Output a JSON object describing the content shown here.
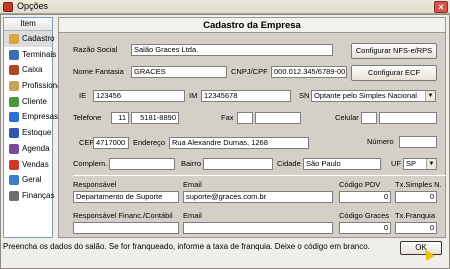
{
  "window": {
    "title": "Opções",
    "close_glyph": "×"
  },
  "sidebar": {
    "header": "Item",
    "items": [
      {
        "label": "Cadastro",
        "icon": "folder-icon",
        "color": "#d9a441"
      },
      {
        "label": "Terminais",
        "icon": "computer-icon",
        "color": "#3a6fb0"
      },
      {
        "label": "Caixa",
        "icon": "cash-register-icon",
        "color": "#b5471f"
      },
      {
        "label": "Profissional",
        "icon": "person-icon",
        "color": "#c8a25a"
      },
      {
        "label": "Cliente",
        "icon": "customer-icon",
        "color": "#4a9a3b"
      },
      {
        "label": "Empresas",
        "icon": "info-icon",
        "color": "#2e6fd3"
      },
      {
        "label": "Estoque",
        "icon": "stock-icon",
        "color": "#2f58a8"
      },
      {
        "label": "Agenda",
        "icon": "calendar-icon",
        "color": "#7a4a9a"
      },
      {
        "label": "Vendas",
        "icon": "sales-icon",
        "color": "#d0392b"
      },
      {
        "label": "Geral",
        "icon": "general-icon",
        "color": "#3c7cc9"
      },
      {
        "label": "Finanças",
        "icon": "finance-icon",
        "color": "#6e6e6e"
      }
    ]
  },
  "form": {
    "title": "Cadastro da Empresa",
    "razao_social_label": "Razão Social",
    "razao_social": "Salão Graces Ltda.",
    "nome_fantasia_label": "Nome Fantasia",
    "nome_fantasia": "GRACES",
    "cnpj_label": "CNPJ/CPF",
    "cnpj": "000.012.345/6789-00",
    "btn_nfs": "Configurar NFS-e/RPS",
    "btn_ecf": "Configurar ECF",
    "ie_label": "IE",
    "ie": "123456",
    "im_label": "IM",
    "im": "12345678",
    "sn_label": "SN",
    "sn": "Optante pelo Simples Nacional",
    "telefone_label": "Telefone",
    "ddd": "11",
    "telefone": "5181-8890",
    "fax_label": "Fax",
    "fax_ddd": "",
    "fax": "",
    "celular_label": "Celular",
    "celular_ddd": "",
    "celular": "",
    "cep_label": "CEP",
    "cep": "4717000",
    "endereco_label": "Endereço",
    "endereco": "Rua Alexandre Dumas, 1268",
    "numero_label": "Número",
    "numero": "",
    "complem_label": "Complem.",
    "complem": "",
    "bairro_label": "Bairro",
    "bairro": "",
    "cidade_label": "Cidade",
    "cidade": "São Paulo",
    "uf_label": "UF",
    "uf": "SP",
    "responsavel_label": "Responsável",
    "responsavel": "Departamento de Suporte",
    "email_label": "Email",
    "email": "suporte@graces.com.br",
    "codigo_pdv_label": "Código PDV",
    "codigo_pdv": "0",
    "tx_simples_label": "Tx.Simples N.",
    "tx_simples": "0",
    "resp_fin_label": "Responsável Financ./Contábil",
    "resp_fin": "",
    "email2_label": "Email",
    "email2": "",
    "codigo_graces_label": "Código Graces",
    "codigo_graces": "0",
    "tx_franquia_label": "Tx.Franquia",
    "tx_franquia": "0"
  },
  "status": "Preencha os dados do salão. Se for franqueado, informe a taxa de franquia. Deixe o código em branco.",
  "ok_label": "OK"
}
